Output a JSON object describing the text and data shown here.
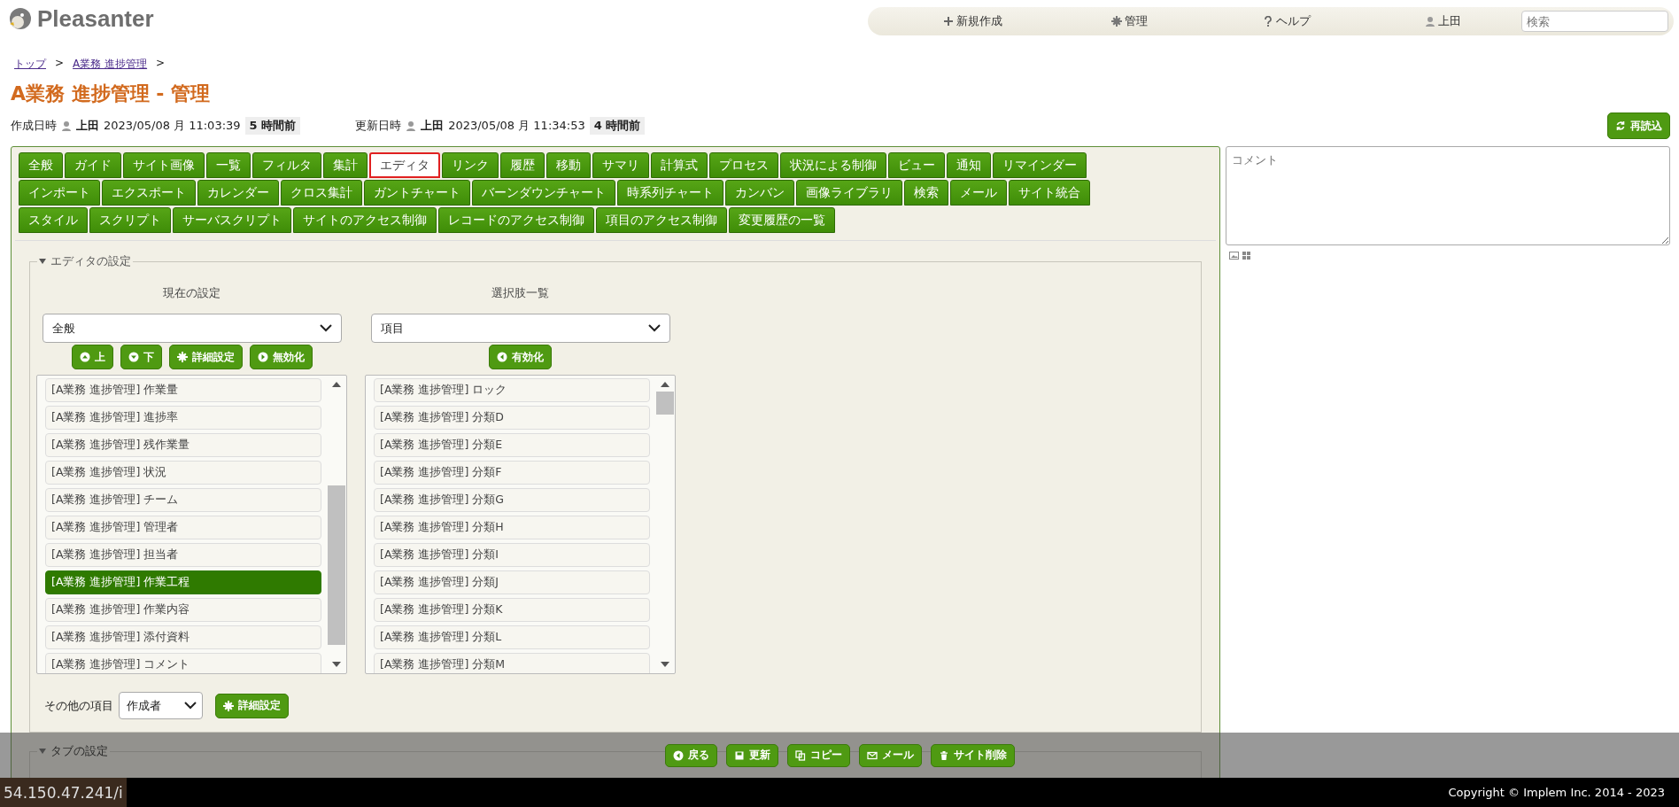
{
  "header": {
    "logo": "Pleasanter",
    "nav": [
      {
        "kind": "plus",
        "label": "新規作成"
      },
      {
        "kind": "gear",
        "label": "管理"
      },
      {
        "kind": "question",
        "label": "ヘルプ"
      },
      {
        "kind": "user",
        "label": "上田"
      }
    ],
    "search": {
      "placeholder": "検索"
    }
  },
  "breadcrumb": [
    {
      "label": "トップ",
      "separator": ">"
    },
    {
      "label": "A業務 進捗管理",
      "separator": ">"
    }
  ],
  "title": "A業務 進捗管理 - 管理",
  "meta": [
    {
      "label": "作成日時",
      "user": "上田",
      "datetime": "2023/05/08 月 11:03:39",
      "elapsed": "5 時間前"
    },
    {
      "label": "更新日時",
      "user": "上田",
      "datetime": "2023/05/08 月 11:34:53",
      "elapsed": "4 時間前"
    }
  ],
  "reload_button": {
    "kind": "refresh",
    "label": "再読込"
  },
  "tabs": [
    [
      {
        "label": "全般",
        "selected": false
      },
      {
        "label": "ガイド",
        "selected": false
      },
      {
        "label": "サイト画像",
        "selected": false
      },
      {
        "label": "一覧",
        "selected": false
      },
      {
        "label": "フィルタ",
        "selected": false
      },
      {
        "label": "集計",
        "selected": false
      },
      {
        "label": "エディタ",
        "selected": true
      },
      {
        "label": "リンク",
        "selected": false
      },
      {
        "label": "履歴",
        "selected": false
      },
      {
        "label": "移動",
        "selected": false
      },
      {
        "label": "サマリ",
        "selected": false
      },
      {
        "label": "計算式",
        "selected": false
      },
      {
        "label": "プロセス",
        "selected": false
      },
      {
        "label": "状況による制御",
        "selected": false
      },
      {
        "label": "ビュー",
        "selected": false
      },
      {
        "label": "通知",
        "selected": false
      },
      {
        "label": "リマインダー",
        "selected": false
      }
    ],
    [
      {
        "label": "インポート",
        "selected": false
      },
      {
        "label": "エクスポート",
        "selected": false
      },
      {
        "label": "カレンダー",
        "selected": false
      },
      {
        "label": "クロス集計",
        "selected": false
      },
      {
        "label": "ガントチャート",
        "selected": false
      },
      {
        "label": "バーンダウンチャート",
        "selected": false
      },
      {
        "label": "時系列チャート",
        "selected": false
      },
      {
        "label": "カンバン",
        "selected": false
      },
      {
        "label": "画像ライブラリ",
        "selected": false
      },
      {
        "label": "検索",
        "selected": false
      },
      {
        "label": "メール",
        "selected": false
      },
      {
        "label": "サイト統合",
        "selected": false
      }
    ],
    [
      {
        "label": "スタイル",
        "selected": false
      },
      {
        "label": "スクリプト",
        "selected": false
      },
      {
        "label": "サーバスクリプト",
        "selected": false
      },
      {
        "label": "サイトのアクセス制御",
        "selected": false
      },
      {
        "label": "レコードのアクセス制御",
        "selected": false
      },
      {
        "label": "項目のアクセス制御",
        "selected": false
      },
      {
        "label": "変更履歴の一覧",
        "selected": false
      }
    ]
  ],
  "comment": {
    "placeholder": "コメント"
  },
  "editor_section": {
    "legend": "エディタの設定",
    "expanded": true,
    "columns": [
      {
        "heading": "現在の設定",
        "select": "全般",
        "buttons": [
          {
            "kind": "up",
            "label": "上"
          },
          {
            "kind": "down",
            "label": "下"
          },
          {
            "kind": "gear",
            "label": "詳細設定"
          },
          {
            "kind": "right",
            "label": "無効化"
          }
        ],
        "items": [
          {
            "label": "[A業務 進捗管理] 作業量",
            "selected": false
          },
          {
            "label": "[A業務 進捗管理] 進捗率",
            "selected": false
          },
          {
            "label": "[A業務 進捗管理] 残作業量",
            "selected": false
          },
          {
            "label": "[A業務 進捗管理] 状況",
            "selected": false
          },
          {
            "label": "[A業務 進捗管理] チーム",
            "selected": false
          },
          {
            "label": "[A業務 進捗管理] 管理者",
            "selected": false
          },
          {
            "label": "[A業務 進捗管理] 担当者",
            "selected": false
          },
          {
            "label": "[A業務 進捗管理] 作業工程",
            "selected": true
          },
          {
            "label": "[A業務 進捗管理] 作業内容",
            "selected": false
          },
          {
            "label": "[A業務 進捗管理] 添付資料",
            "selected": false
          },
          {
            "label": "[A業務 進捗管理] コメント",
            "selected": false
          }
        ]
      },
      {
        "heading": "選択肢一覧",
        "select": "項目",
        "buttons": [
          {
            "kind": "left",
            "label": "有効化"
          }
        ],
        "items": [
          {
            "label": "[A業務 進捗管理] ロック",
            "selected": false
          },
          {
            "label": "[A業務 進捗管理] 分類D",
            "selected": false
          },
          {
            "label": "[A業務 進捗管理] 分類E",
            "selected": false
          },
          {
            "label": "[A業務 進捗管理] 分類F",
            "selected": false
          },
          {
            "label": "[A業務 進捗管理] 分類G",
            "selected": false
          },
          {
            "label": "[A業務 進捗管理] 分類H",
            "selected": false
          },
          {
            "label": "[A業務 進捗管理] 分類I",
            "selected": false
          },
          {
            "label": "[A業務 進捗管理] 分類J",
            "selected": false
          },
          {
            "label": "[A業務 進捗管理] 分類K",
            "selected": false
          },
          {
            "label": "[A業務 進捗管理] 分類L",
            "selected": false
          },
          {
            "label": "[A業務 進捗管理] 分類M",
            "selected": false
          }
        ]
      }
    ],
    "other_items": {
      "label": "その他の項目",
      "select": "作成者",
      "button": {
        "kind": "gear",
        "label": "詳細設定"
      }
    }
  },
  "tab_section": {
    "legend": "タブの設定",
    "expanded": true
  },
  "footer_buttons": [
    {
      "kind": "back",
      "label": "戻る"
    },
    {
      "kind": "save",
      "label": "更新"
    },
    {
      "kind": "copy",
      "label": "コピー"
    },
    {
      "kind": "mail",
      "label": "メール"
    },
    {
      "kind": "trash",
      "label": "サイト削除"
    }
  ],
  "status_url": "54.150.47.241/i",
  "copyright": "Copyright © Implem Inc. 2014 - 2023"
}
